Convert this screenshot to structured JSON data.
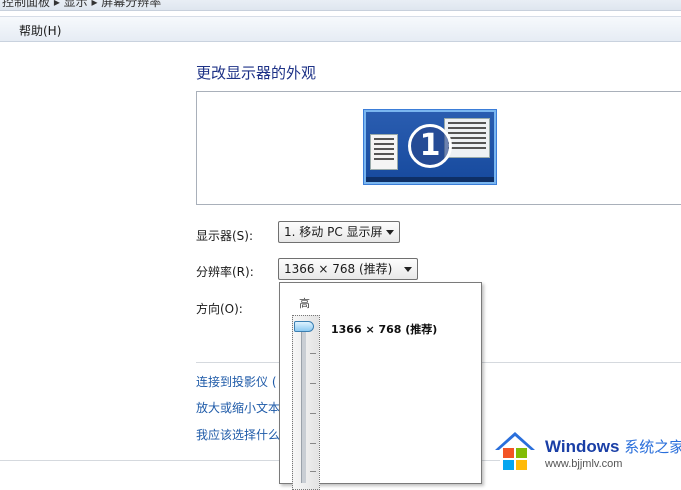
{
  "window": {
    "breadcrumb": "控制面板 ▸ 显示 ▸ 屏幕分辨率"
  },
  "menubar": {
    "help": "帮助(H)"
  },
  "main": {
    "title": "更改显示器的外观",
    "monitor_number": "1",
    "display_label": "显示器(S):",
    "display_value": "1. 移动 PC 显示屏",
    "resolution_label": "分辨率(R):",
    "resolution_value": "1366 × 768 (推荐)",
    "orientation_label": "方向(O):"
  },
  "dropdown": {
    "high_label": "高",
    "selected_resolution": "1366 × 768 (推荐)",
    "slider_level": "top"
  },
  "links": {
    "projector": "连接到投影仪 (",
    "text_size": "放大或缩小文本",
    "which_settings": "我应该选择什么"
  },
  "watermark": {
    "brand": "Windows",
    "brand_cn": "系统之家",
    "url": "www.bjjmlv.com",
    "colors": [
      "#f35325",
      "#81bc06",
      "#05a6f0",
      "#ffba08"
    ]
  }
}
